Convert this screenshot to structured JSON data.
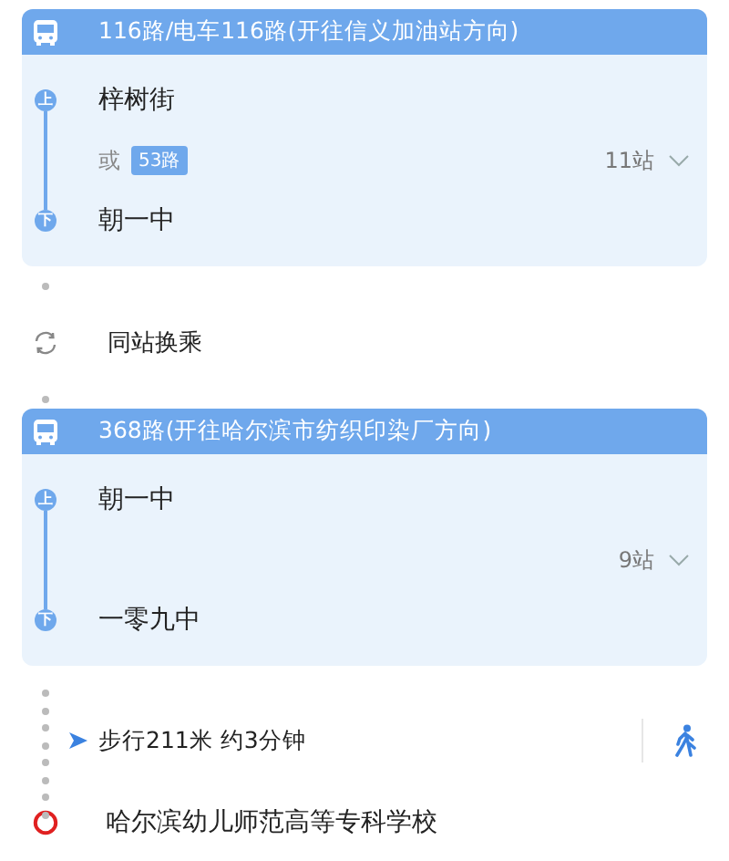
{
  "segments": [
    {
      "kind": "bus",
      "route": "116路/电车116路(开往信义加油站方向)",
      "board_badge": "上",
      "board_stop": "梓树街",
      "alt_label": "或",
      "alt_route": "53路",
      "stop_count": "11站",
      "alight_badge": "下",
      "alight_stop": "朝一中"
    },
    {
      "kind": "transfer",
      "text": "同站换乘"
    },
    {
      "kind": "bus",
      "route": "368路(开往哈尔滨市纺织印染厂方向)",
      "board_badge": "上",
      "board_stop": "朝一中",
      "stop_count": "9站",
      "alight_badge": "下",
      "alight_stop": "一零九中"
    },
    {
      "kind": "walk",
      "text": "步行211米 约3分钟"
    },
    {
      "kind": "destination",
      "name": "哈尔滨幼儿师范高等专科学校"
    }
  ]
}
